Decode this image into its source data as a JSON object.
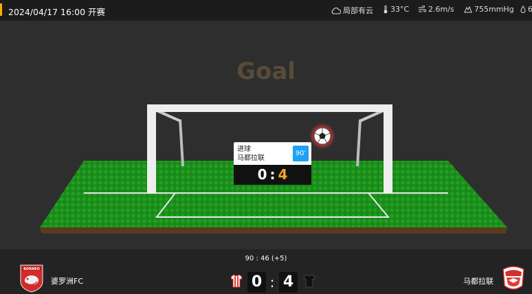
{
  "header": {
    "datetime": "2024/04/17 16:00 开赛",
    "weather": {
      "condition": "局部有云",
      "condition_icon": "cloud-icon",
      "temperature": "33°C",
      "temperature_icon": "thermometer-icon",
      "wind": "2.6m/s",
      "wind_icon": "wind-icon",
      "pressure": "755mmHg",
      "pressure_icon": "pressure-icon",
      "humidity": "6",
      "humidity_icon": "droplet-icon"
    }
  },
  "stage": {
    "title": "Goal",
    "event": {
      "type": "进球",
      "team": "马都拉联",
      "minute": "90'",
      "home_score": "0",
      "separator": ":",
      "away_score": "4"
    }
  },
  "match": {
    "clock": "90 : 46  (+5)",
    "home_team": "婆罗洲FC",
    "away_team": "马都拉联",
    "home_score": "0",
    "away_score": "4",
    "separator": ":",
    "home_logo_text": "BORNEO"
  },
  "colors": {
    "accent": "#f5b400",
    "away_score": "#f5a623",
    "minute_badge": "#1da1f2",
    "pitch": "#1f9a1f"
  }
}
